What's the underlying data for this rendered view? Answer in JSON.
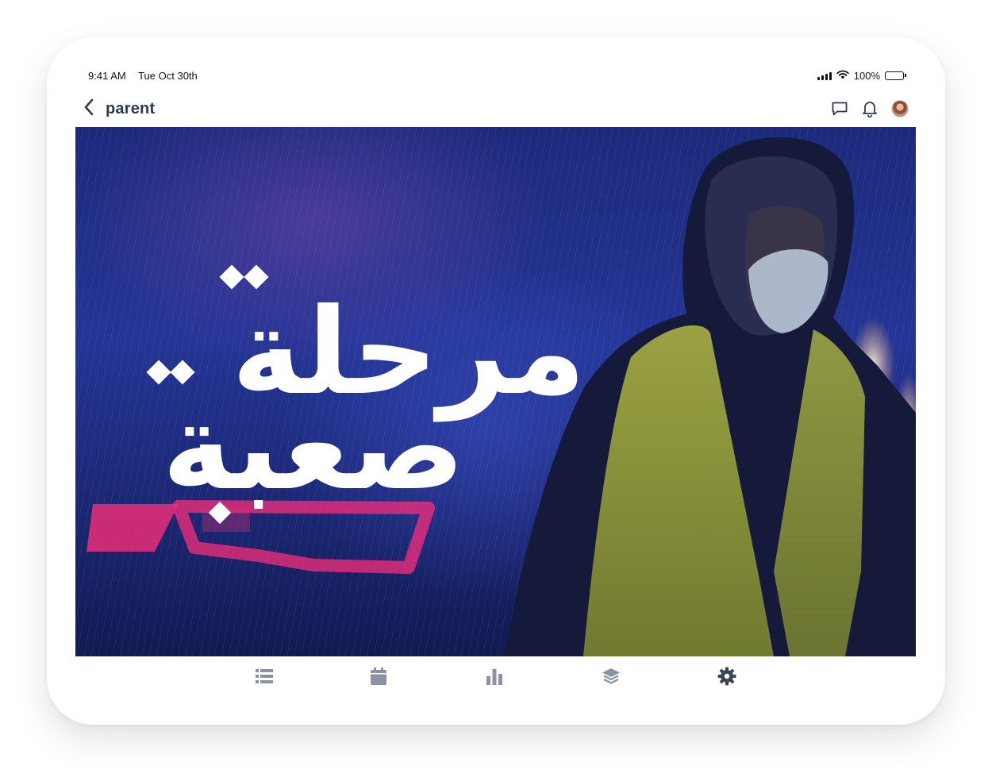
{
  "status_bar": {
    "time": "9:41 AM",
    "date": "Tue Oct 30th",
    "battery": "100%",
    "battery_level": 1.0
  },
  "nav": {
    "title": "parent",
    "icons": [
      "back-chevron-icon",
      "chat-icon",
      "bell-icon",
      "avatar"
    ]
  },
  "hero": {
    "title_lines": [
      "مرحلة",
      "صعبة"
    ]
  },
  "tab_bar": {
    "items": [
      {
        "icon": "list-icon",
        "active": false
      },
      {
        "icon": "calendar-icon",
        "active": false
      },
      {
        "icon": "bar-chart-icon",
        "active": false
      },
      {
        "icon": "layers-icon",
        "active": false
      },
      {
        "icon": "gear-icon",
        "active": true
      }
    ]
  },
  "colors": {
    "nav_text": "#2f3a4f",
    "tab_inactive": "#8a93a6",
    "tab_active": "#3a4559",
    "hero_bg": "#243596",
    "vest": "#b9c23a",
    "tail_light": "#ff2e7a"
  }
}
